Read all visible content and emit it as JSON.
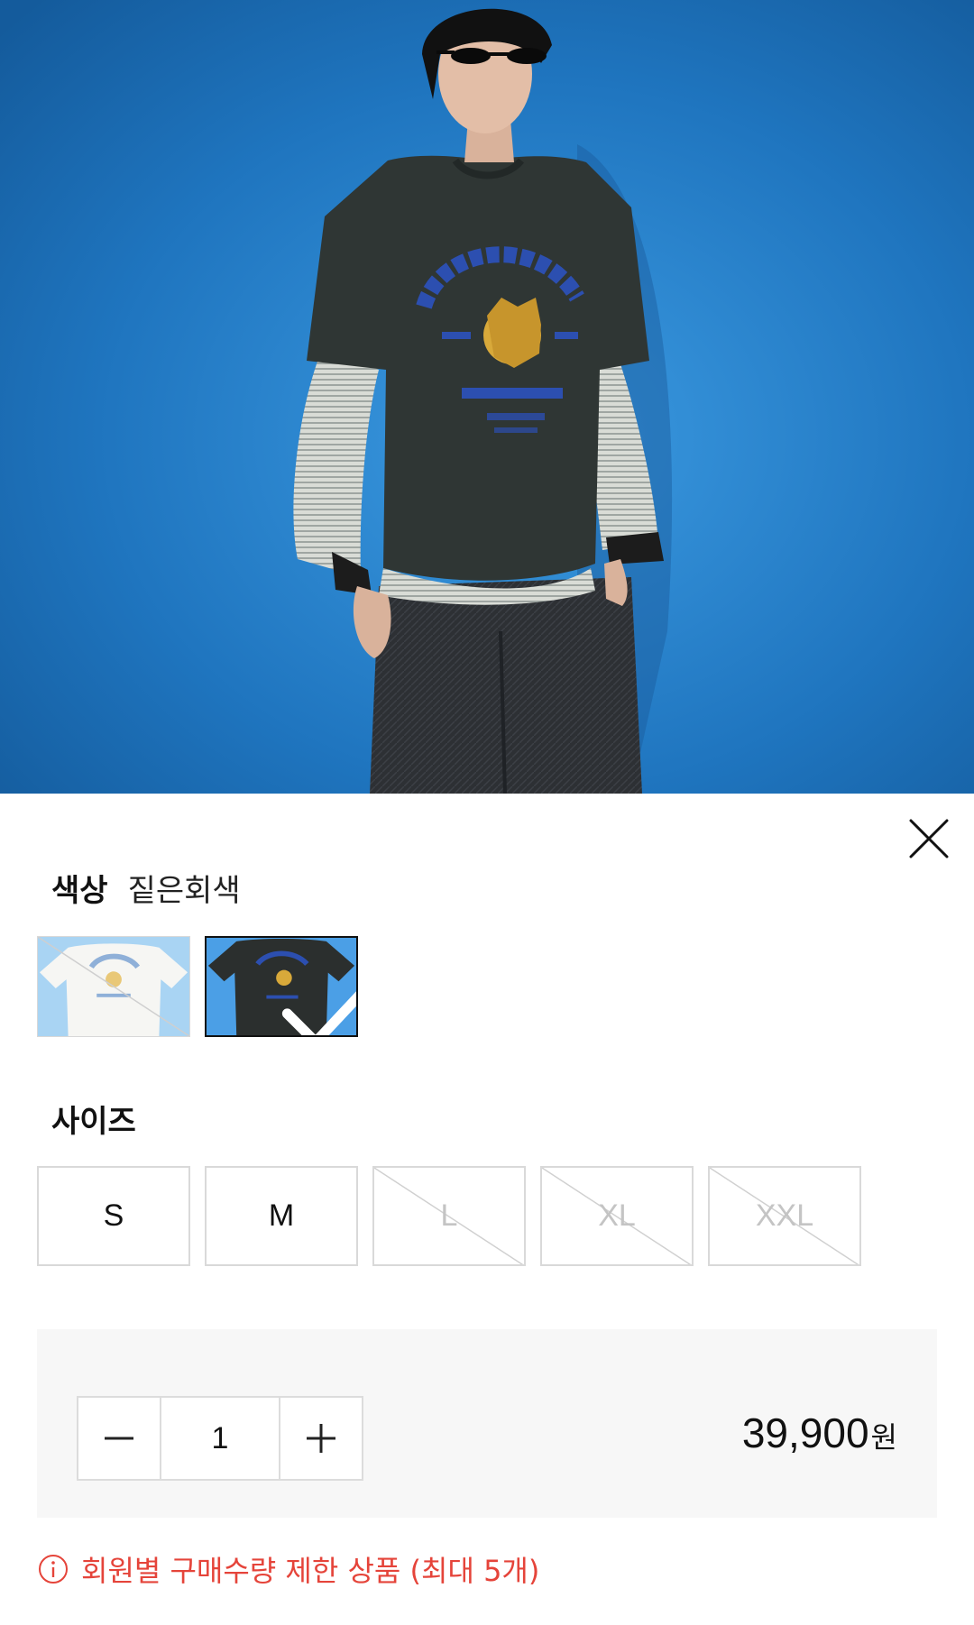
{
  "product": {
    "image_alt": "Always Blue lion graphic t-shirt worn by model"
  },
  "options": {
    "color_label": "색상",
    "color_value": "짙은회색",
    "swatches": [
      {
        "name": "white",
        "selected": false,
        "sold_out": true
      },
      {
        "name": "dark-gray",
        "selected": true,
        "sold_out": false
      }
    ],
    "size_label": "사이즈",
    "sizes": [
      {
        "label": "S",
        "available": true
      },
      {
        "label": "M",
        "available": true
      },
      {
        "label": "L",
        "available": false
      },
      {
        "label": "XL",
        "available": false
      },
      {
        "label": "XXL",
        "available": false
      }
    ]
  },
  "order": {
    "quantity": "1",
    "price": "39,900",
    "currency": "원"
  },
  "notice": {
    "text": "회원별 구매수량 제한 상품 (최대 5개)"
  },
  "colors": {
    "background_blue": "#1f6fb5",
    "shirt_dark": "#2f3634",
    "warning_red": "#e5443a",
    "print_blue": "#2c4fb0",
    "lion_gold": "#d8a93a"
  },
  "icons": {
    "close": "close-icon",
    "minus": "minus-icon",
    "plus": "plus-icon",
    "info": "info-circle-icon",
    "check": "check-icon"
  }
}
